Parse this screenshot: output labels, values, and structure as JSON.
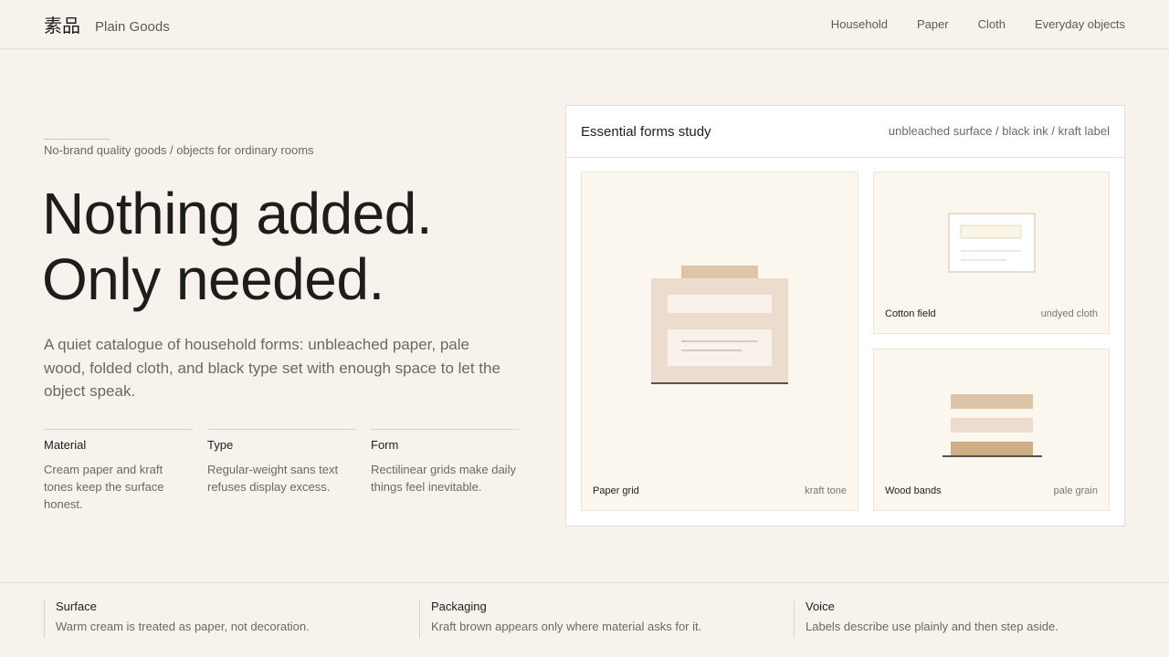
{
  "header": {
    "logo_mark": "素品",
    "brand_name": "Plain Goods",
    "nav": [
      "Household",
      "Paper",
      "Cloth",
      "Everyday objects"
    ]
  },
  "hero": {
    "eyebrow": "No-brand quality goods / objects for ordinary rooms",
    "headline_line1": "Nothing added.",
    "headline_line2": "Only needed.",
    "lede": "A quiet catalogue of household forms: unbleached paper, pale wood, folded cloth, and black type set with enough space to let the object speak.",
    "attributes": [
      {
        "title": "Material",
        "text": "Cream paper and kraft tones keep the surface honest."
      },
      {
        "title": "Type",
        "text": "Regular-weight sans text refuses display excess."
      },
      {
        "title": "Form",
        "text": "Rectilinear grids make daily things feel inevitable."
      }
    ]
  },
  "study": {
    "title": "Essential forms study",
    "meta": "unbleached surface / black ink / kraft label",
    "tiles": [
      {
        "label": "Paper grid",
        "note": "kraft tone"
      },
      {
        "label": "Cotton field",
        "note": "undyed cloth"
      },
      {
        "label": "Wood bands",
        "note": "pale grain"
      }
    ]
  },
  "footer": [
    {
      "title": "Surface",
      "text": "Warm cream is treated as paper, not decoration."
    },
    {
      "title": "Packaging",
      "text": "Kraft brown appears only where material asks for it."
    },
    {
      "title": "Voice",
      "text": "Labels describe use plainly and then step aside."
    }
  ],
  "colors": {
    "background": "#f7f3ec",
    "ink": "#1d1d1b",
    "kraft": "#dcc5a8",
    "kraft_dark": "#cfae86",
    "blush": "#ecdccd",
    "muted_text": "#6b6863"
  }
}
